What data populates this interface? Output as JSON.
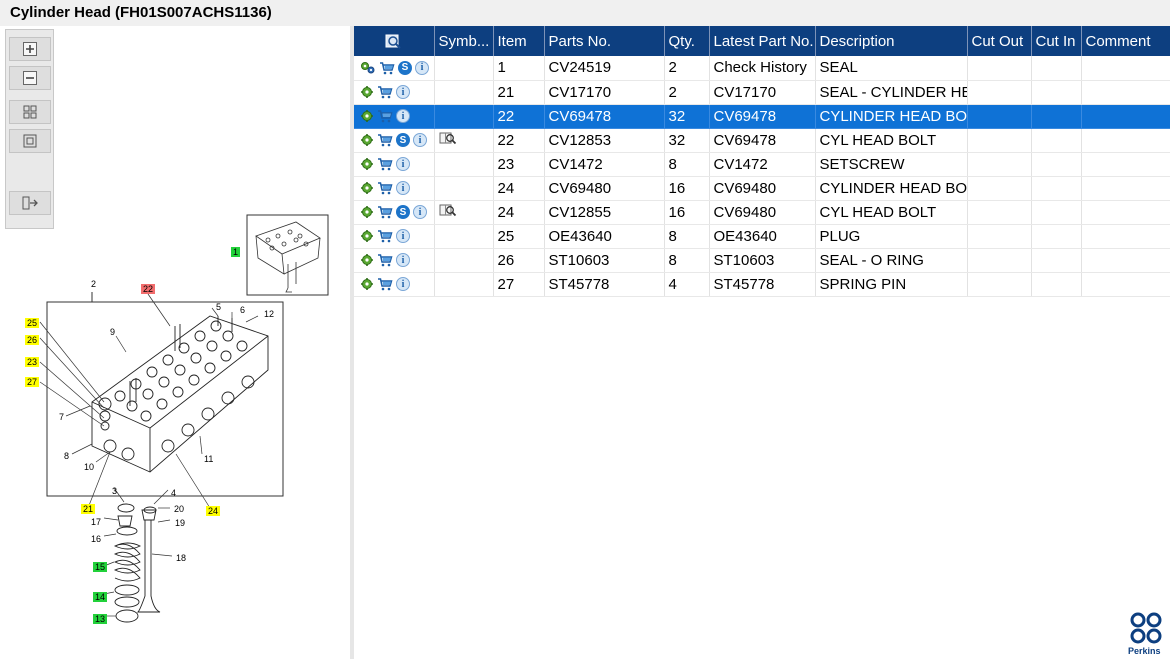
{
  "title": "Cylinder Head (FH01S007ACHS1136)",
  "toolbar": {
    "buttons": [
      "zoom-in-icon",
      "zoom-out-icon",
      "fit-all-icon",
      "fit-window-icon",
      "export-icon"
    ]
  },
  "diagram": {
    "callouts": [
      {
        "label": "1",
        "style": "green"
      },
      {
        "label": "2",
        "style": "plain"
      },
      {
        "label": "22",
        "style": "red"
      },
      {
        "label": "5",
        "style": "plain"
      },
      {
        "label": "6",
        "style": "plain"
      },
      {
        "label": "12",
        "style": "plain"
      },
      {
        "label": "9",
        "style": "plain"
      },
      {
        "label": "25",
        "style": "yellow"
      },
      {
        "label": "26",
        "style": "yellow"
      },
      {
        "label": "23",
        "style": "yellow"
      },
      {
        "label": "27",
        "style": "yellow"
      },
      {
        "label": "7",
        "style": "plain"
      },
      {
        "label": "8",
        "style": "plain"
      },
      {
        "label": "10",
        "style": "plain"
      },
      {
        "label": "11",
        "style": "plain"
      },
      {
        "label": "3",
        "style": "plain"
      },
      {
        "label": "4",
        "style": "plain"
      },
      {
        "label": "21",
        "style": "yellow"
      },
      {
        "label": "24",
        "style": "yellow"
      },
      {
        "label": "17",
        "style": "plain"
      },
      {
        "label": "20",
        "style": "plain"
      },
      {
        "label": "19",
        "style": "plain"
      },
      {
        "label": "16",
        "style": "plain"
      },
      {
        "label": "18",
        "style": "plain"
      },
      {
        "label": "15",
        "style": "green"
      },
      {
        "label": "14",
        "style": "green"
      },
      {
        "label": "13",
        "style": "green"
      }
    ]
  },
  "table": {
    "columns": [
      "",
      "Symb...",
      "Item",
      "Parts No.",
      "Qty.",
      "Latest Part No.",
      "Description",
      "Cut Out",
      "Cut In",
      "Comment"
    ],
    "rows": [
      {
        "icons": [
          "gears",
          "cart",
          "s",
          "i"
        ],
        "symbol": "",
        "item": "1",
        "part": "CV24519",
        "qty": "2",
        "latest": "Check History",
        "desc": "SEAL",
        "selected": false
      },
      {
        "icons": [
          "gear",
          "cart",
          "i"
        ],
        "symbol": "",
        "item": "21",
        "part": "CV17170",
        "qty": "2",
        "latest": "CV17170",
        "desc": "SEAL - CYLINDER HEAD",
        "selected": false
      },
      {
        "icons": [
          "gear",
          "cart",
          "i"
        ],
        "symbol": "",
        "item": "22",
        "part": "CV69478",
        "qty": "32",
        "latest": "CV69478",
        "desc": "CYLINDER HEAD BOLT",
        "selected": true
      },
      {
        "icons": [
          "gear",
          "cart",
          "s",
          "i"
        ],
        "symbol": "book",
        "item": "22",
        "part": "CV12853",
        "qty": "32",
        "latest": "CV69478",
        "desc": "CYL HEAD BOLT",
        "selected": false
      },
      {
        "icons": [
          "gear",
          "cart",
          "i"
        ],
        "symbol": "",
        "item": "23",
        "part": "CV1472",
        "qty": "8",
        "latest": "CV1472",
        "desc": "SETSCREW",
        "selected": false
      },
      {
        "icons": [
          "gear",
          "cart",
          "i"
        ],
        "symbol": "",
        "item": "24",
        "part": "CV69480",
        "qty": "16",
        "latest": "CV69480",
        "desc": "CYLINDER HEAD BOLT",
        "selected": false
      },
      {
        "icons": [
          "gear",
          "cart",
          "s",
          "i"
        ],
        "symbol": "book",
        "item": "24",
        "part": "CV12855",
        "qty": "16",
        "latest": "CV69480",
        "desc": "CYL HEAD BOLT",
        "selected": false
      },
      {
        "icons": [
          "gear",
          "cart",
          "i"
        ],
        "symbol": "",
        "item": "25",
        "part": "OE43640",
        "qty": "8",
        "latest": "OE43640",
        "desc": "PLUG",
        "selected": false
      },
      {
        "icons": [
          "gear",
          "cart",
          "i"
        ],
        "symbol": "",
        "item": "26",
        "part": "ST10603",
        "qty": "8",
        "latest": "ST10603",
        "desc": "SEAL - O RING",
        "selected": false
      },
      {
        "icons": [
          "gear",
          "cart",
          "i"
        ],
        "symbol": "",
        "item": "27",
        "part": "ST45778",
        "qty": "4",
        "latest": "ST45778",
        "desc": "SPRING PIN",
        "selected": false
      }
    ]
  },
  "brand": {
    "name": "Perkins",
    "color": "#0d3f80"
  },
  "colors": {
    "header_bg": "#0d3f80",
    "selected_row": "#0f72d6",
    "callout_yellow": "#ffff00",
    "callout_red": "#f26d6d",
    "callout_green": "#22d13a"
  }
}
